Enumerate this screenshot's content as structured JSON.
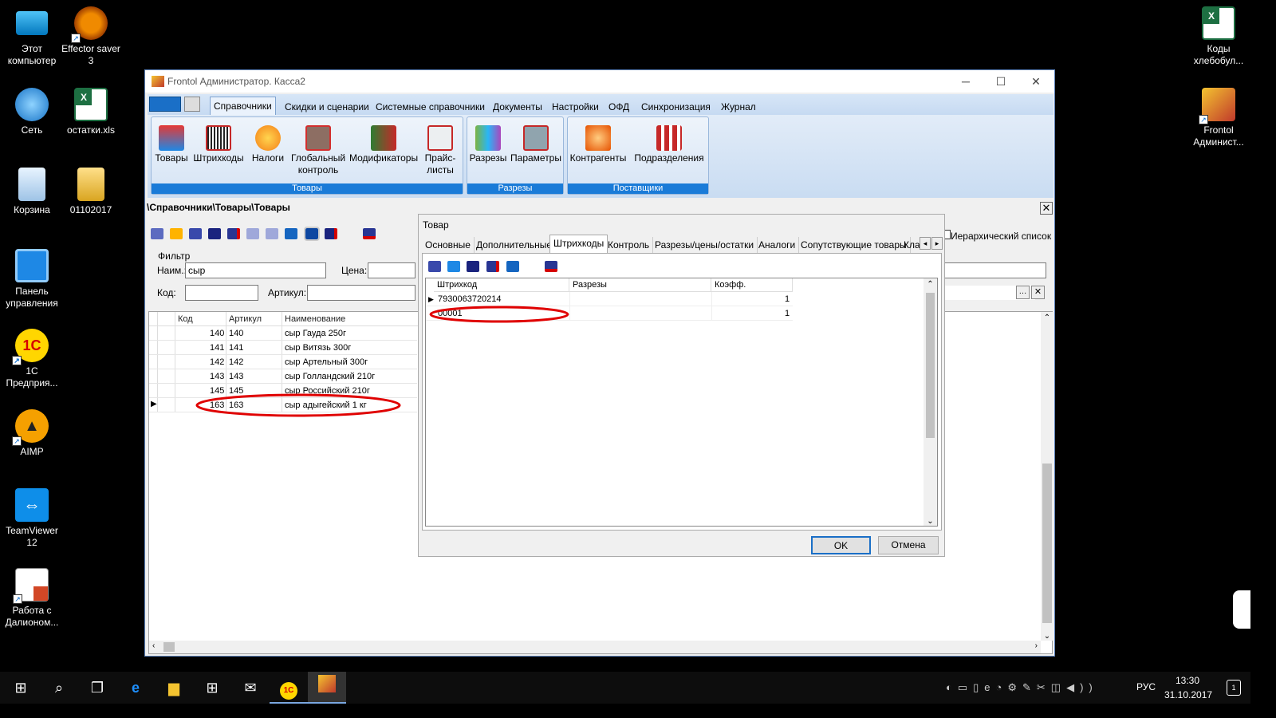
{
  "desktop": {
    "left_icons": [
      {
        "label": "Этот компьютер"
      },
      {
        "label": "Effector saver 3"
      },
      {
        "label": "Сеть"
      },
      {
        "label": "остатки.xls"
      },
      {
        "label": "Корзина"
      },
      {
        "label": "01102017"
      },
      {
        "label": "Панель управления"
      },
      {
        "label": "1С Предприя..."
      },
      {
        "label": "AIMP"
      },
      {
        "label": "TeamViewer 12"
      },
      {
        "label": "Работа с Далионом..."
      }
    ],
    "right_icons": [
      {
        "label": "Коды хлебобул..."
      },
      {
        "label": "Frontol Админист..."
      }
    ]
  },
  "window": {
    "title": "Frontol Администратор. Касса2",
    "menu_tabs": [
      "Справочники",
      "Скидки и сценарии",
      "Системные справочники",
      "Документы",
      "Настройки",
      "ОФД",
      "Синхронизация",
      "Журнал"
    ],
    "ribbon_groups": [
      {
        "label": "Товары",
        "buttons": [
          "Товары",
          "Штрихкоды",
          "Налоги",
          "Глобальный контроль",
          "Модификаторы",
          "Прайс-листы"
        ]
      },
      {
        "label": "Разрезы",
        "buttons": [
          "Разрезы",
          "Параметры"
        ]
      },
      {
        "label": "Поставщики",
        "buttons": [
          "Контрагенты",
          "Подразделения"
        ]
      }
    ],
    "path": "\\Справочники\\Товары\\Товары",
    "hier_label": "Иерархический список",
    "filter": {
      "title": "Фильтр",
      "name_label": "Наим.:",
      "name_value": "сыр",
      "price_label": "Цена:",
      "price_value": "",
      "code_label": "Код:",
      "code_value": "",
      "article_label": "Артикул:",
      "article_value": ""
    },
    "grid": {
      "columns": [
        "Код",
        "Артикул",
        "Наименование"
      ],
      "rows": [
        {
          "code": "140",
          "article": "140",
          "name": "сыр Гауда 250г"
        },
        {
          "code": "141",
          "article": "141",
          "name": "сыр Витязь 300г"
        },
        {
          "code": "142",
          "article": "142",
          "name": "сыр Артельный 300г"
        },
        {
          "code": "143",
          "article": "143",
          "name": "сыр Голландский 210г"
        },
        {
          "code": "145",
          "article": "145",
          "name": "сыр Российский 210г"
        },
        {
          "code": "163",
          "article": "163",
          "name": "сыр адыгейский 1 кг"
        }
      ]
    }
  },
  "dialog": {
    "title": "Товар",
    "tabs": [
      "Основные",
      "Дополнительные",
      "Штрихкоды",
      "Контроль",
      "Разрезы/цены/остатки",
      "Аналоги",
      "Сопутствующие товары",
      "Кла"
    ],
    "barcode_columns": [
      "Штрихкод",
      "Разрезы",
      "Коэфф."
    ],
    "barcodes": [
      {
        "barcode": "7930063720214",
        "sections": "",
        "coef": "1"
      },
      {
        "barcode": "00001",
        "sections": "",
        "coef": "1"
      }
    ],
    "ok": "OK",
    "cancel": "Отмена"
  },
  "taskbar": {
    "lang": "РУС",
    "time": "13:30",
    "date": "31.10.2017"
  },
  "colors": {
    "accent": "#1a7bd8",
    "annotation": "#e00000"
  }
}
